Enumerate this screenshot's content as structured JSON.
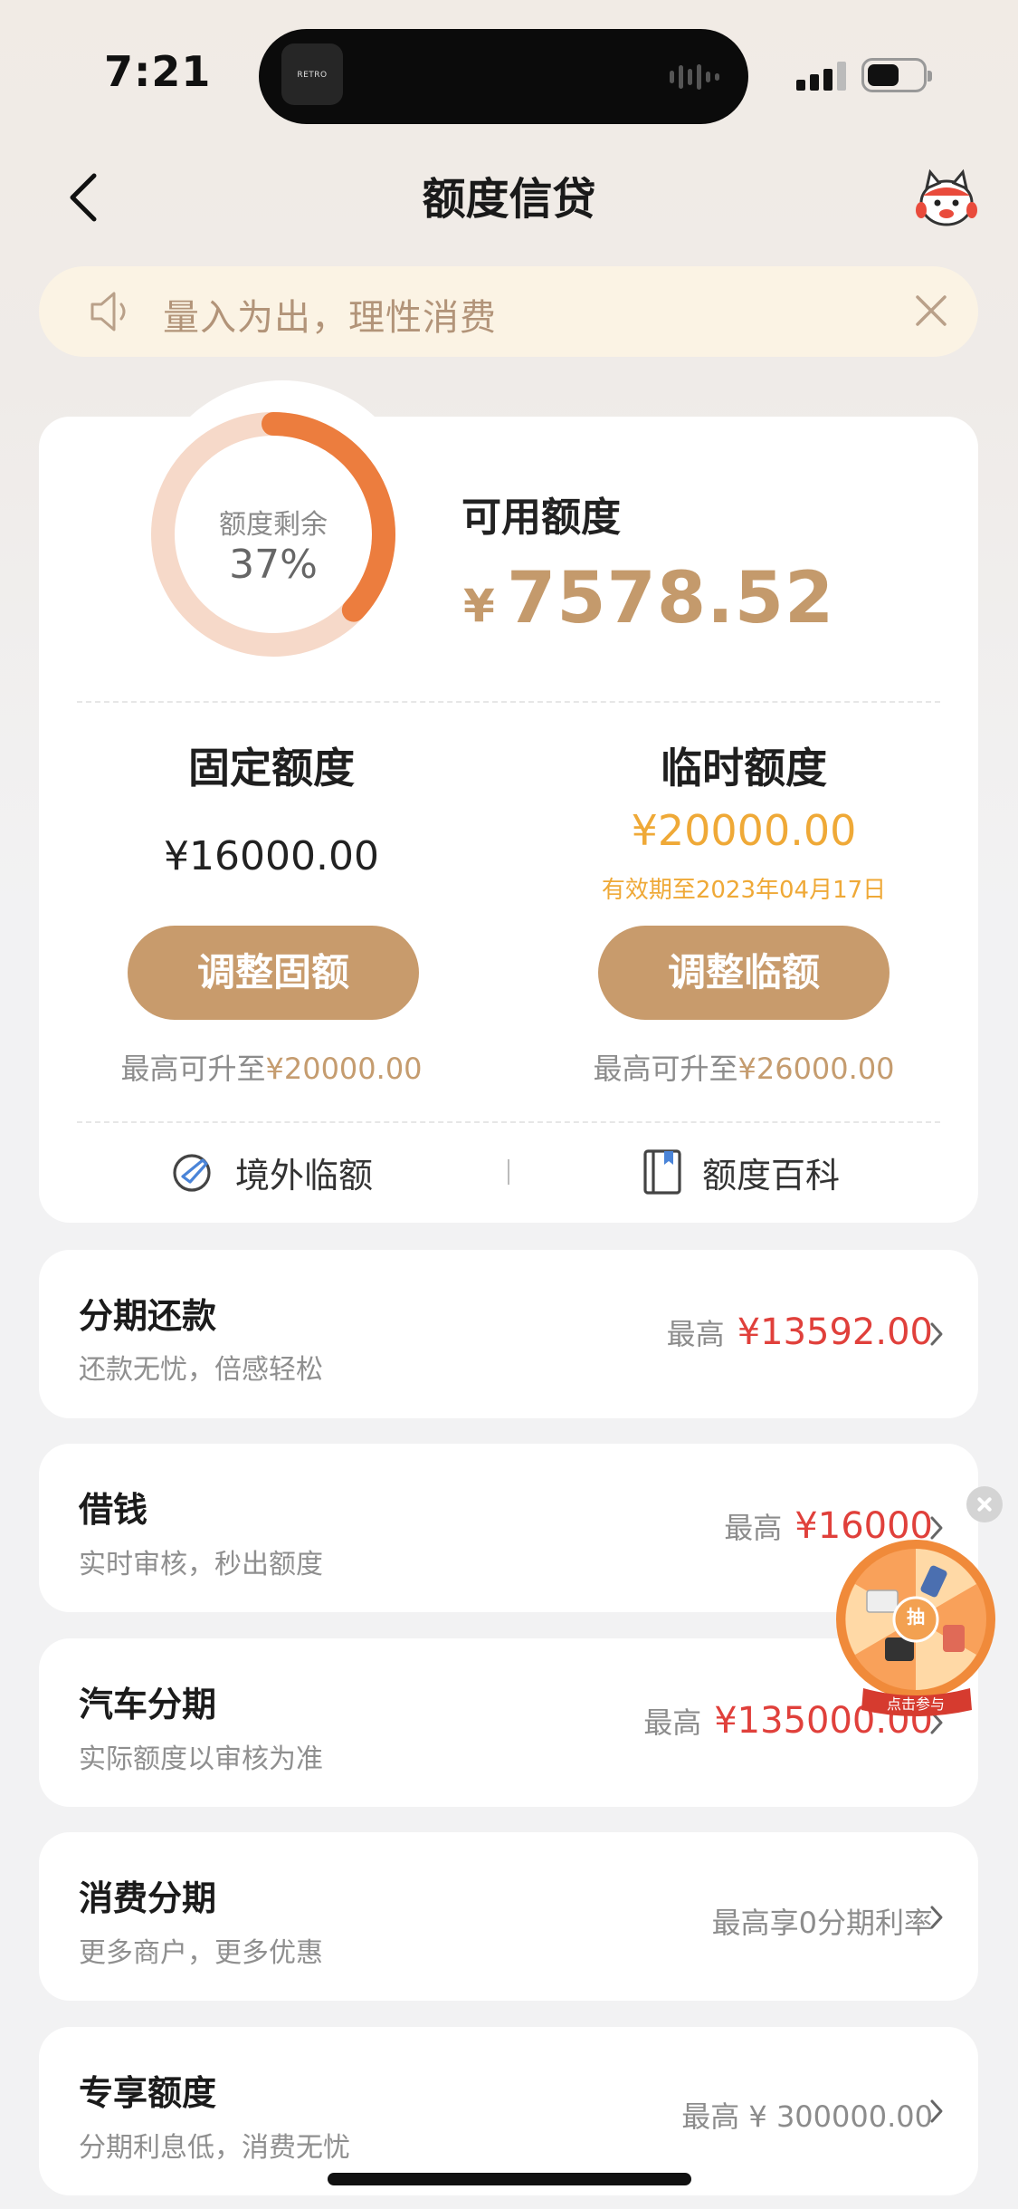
{
  "status_bar": {
    "time": "7:21",
    "island_app_label": "RETRO"
  },
  "header": {
    "title": "额度信贷"
  },
  "notice": {
    "text": "量入为出，理性消费"
  },
  "summary": {
    "ring_label": "额度剩余",
    "ring_percent": "37%",
    "ring_fraction": 0.37,
    "available_label": "可用额度",
    "currency_symbol": "¥",
    "available_amount": "7578.52"
  },
  "fixed_limit": {
    "title": "固定额度",
    "amount": "¥16000.00",
    "button_label": "调整固额",
    "max_prefix": "最高可升至",
    "max_value": "¥20000.00"
  },
  "temp_limit": {
    "title": "临时额度",
    "amount": "¥20000.00",
    "valid_until": "有效期至2023年04月17日",
    "button_label": "调整临额",
    "max_prefix": "最高可升至",
    "max_value": "¥26000.00"
  },
  "links": [
    {
      "label": "境外临额",
      "icon": "plane-globe-icon"
    },
    {
      "label": "额度百科",
      "icon": "book-icon"
    }
  ],
  "rows": [
    {
      "title": "分期还款",
      "subtitle": "还款无忧，倍感轻松",
      "prefix": "最高",
      "value": "¥13592.00"
    },
    {
      "title": "借钱",
      "subtitle": "实时审核，秒出额度",
      "prefix": "最高",
      "value": "¥16000"
    },
    {
      "title": "汽车分期",
      "subtitle": "实际额度以审核为准",
      "prefix": "最高",
      "value": "¥135000.00"
    },
    {
      "title": "消费分期",
      "subtitle": "更多商户，更多优惠",
      "prefix": "最高享0分期利率",
      "value": ""
    },
    {
      "title": "专享额度",
      "subtitle": "分期利息低，消费无忧",
      "prefix": "最高 ¥ 300000.00",
      "value": ""
    }
  ],
  "lottery": {
    "center_label": "抽",
    "button_label": "点击参与"
  },
  "colors": {
    "accent_gold": "#c89b6c",
    "ring_orange": "#ec7d3e",
    "ring_track": "#f6d9c9",
    "temp_yellow": "#efa937",
    "amount_red": "#e0403b"
  }
}
